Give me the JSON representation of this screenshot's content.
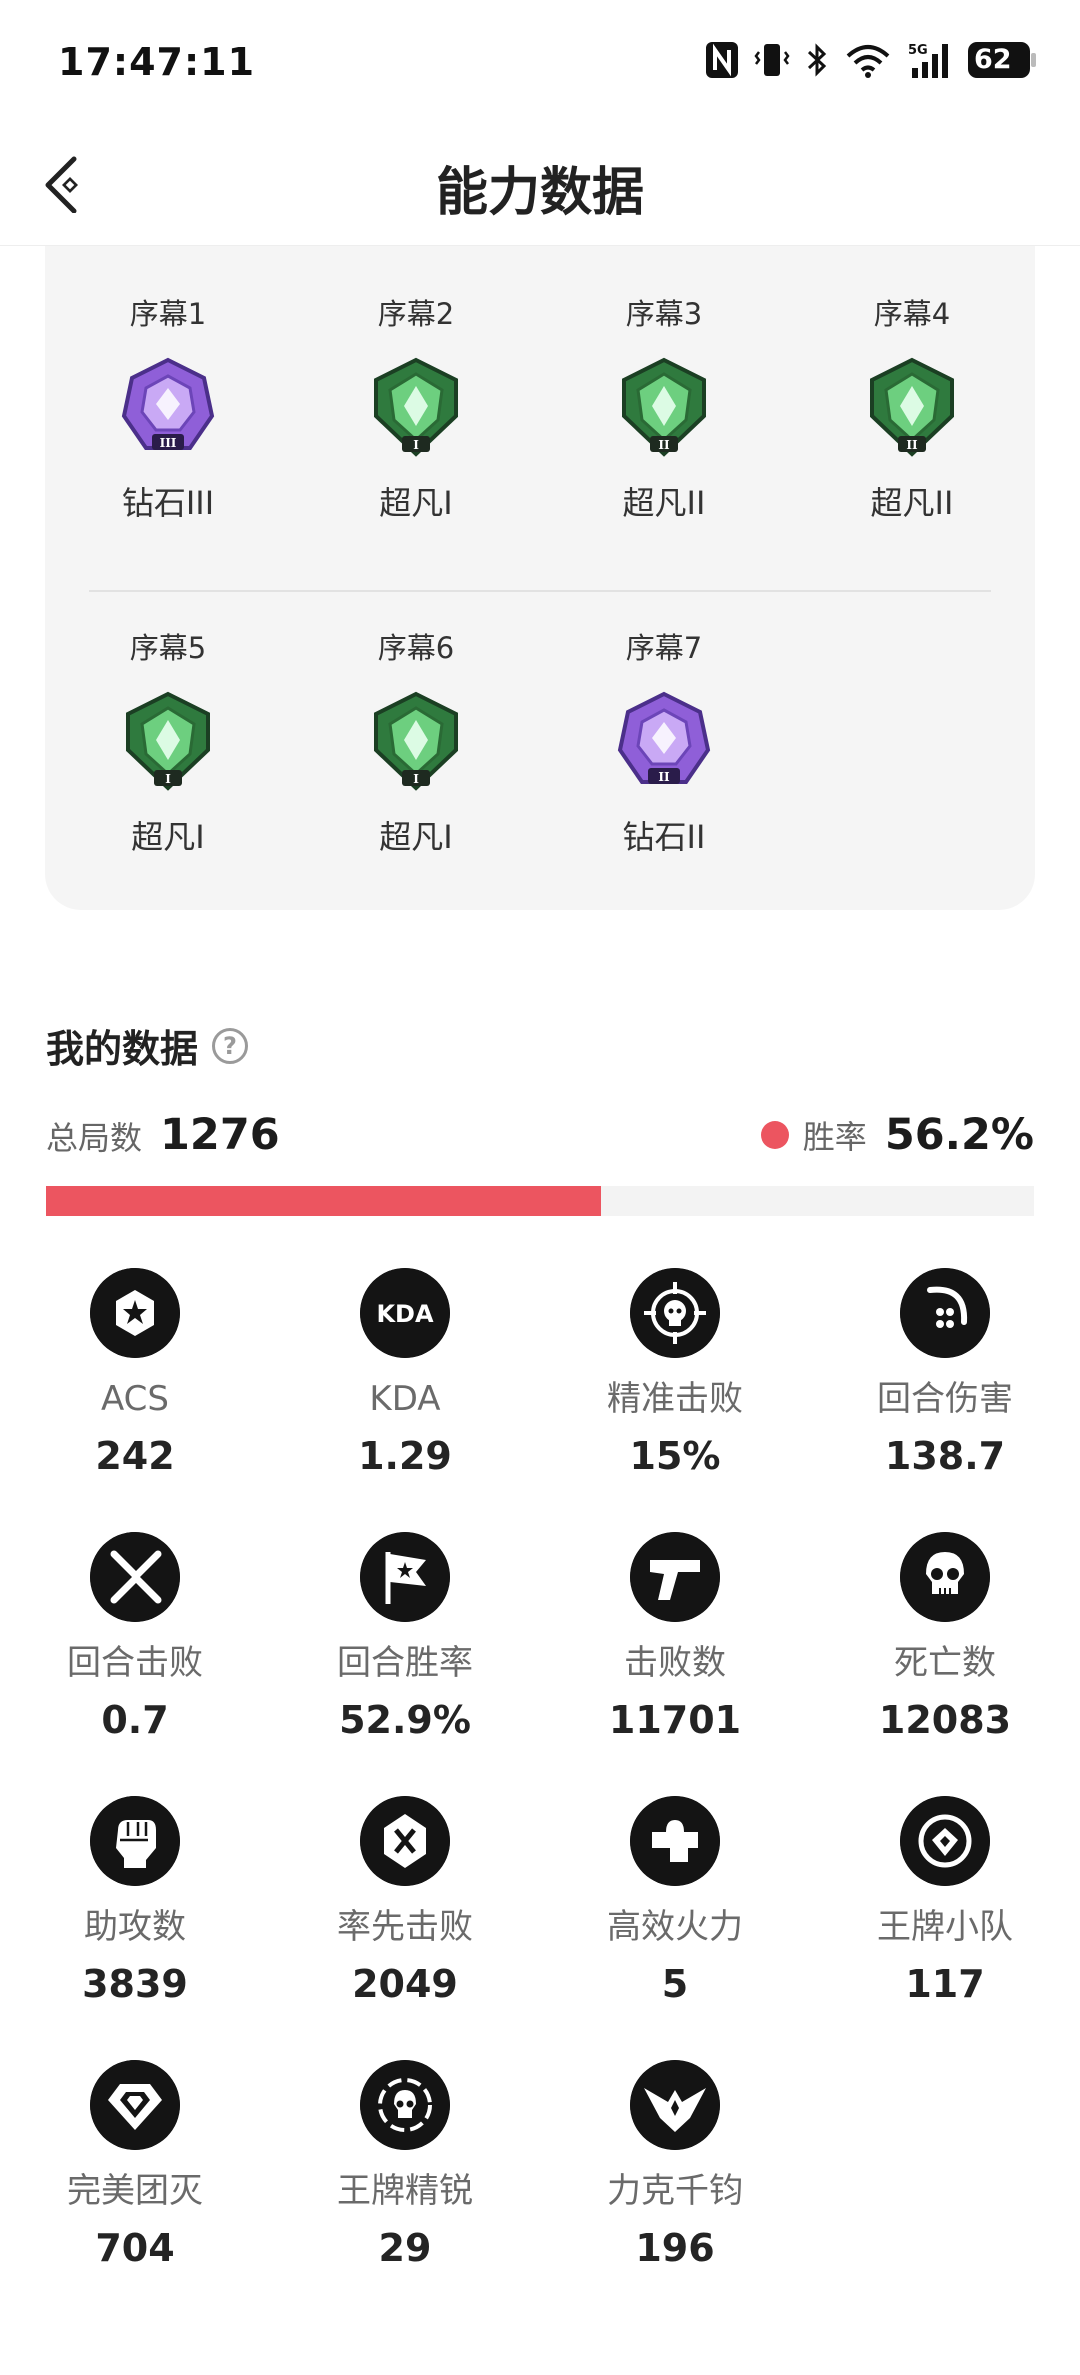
{
  "status_bar": {
    "time": "17:47:11",
    "battery": "62"
  },
  "header": {
    "title": "能力数据"
  },
  "ranks": [
    {
      "act": "序幕1",
      "rank": "钻石III",
      "tier": "diamond",
      "numeral": "III"
    },
    {
      "act": "序幕2",
      "rank": "超凡I",
      "tier": "ascendant",
      "numeral": "I"
    },
    {
      "act": "序幕3",
      "rank": "超凡II",
      "tier": "ascendant",
      "numeral": "II"
    },
    {
      "act": "序幕4",
      "rank": "超凡II",
      "tier": "ascendant",
      "numeral": "II"
    },
    {
      "act": "序幕5",
      "rank": "超凡I",
      "tier": "ascendant",
      "numeral": "I"
    },
    {
      "act": "序幕6",
      "rank": "超凡I",
      "tier": "ascendant",
      "numeral": "I"
    },
    {
      "act": "序幕7",
      "rank": "钻石II",
      "tier": "diamond",
      "numeral": "II"
    }
  ],
  "my_data": {
    "title": "我的数据",
    "help_icon": "question-circle-icon",
    "total_label": "总局数",
    "total_value": "1276",
    "winrate_label": "胜率",
    "winrate_value": "56.2%",
    "winrate_fraction": 0.562,
    "accent_color": "#ec5560"
  },
  "stats": [
    {
      "label": "ACS",
      "value": "242",
      "icon": "star-badge-icon"
    },
    {
      "label": "KDA",
      "value": "1.29",
      "icon": "kda-icon",
      "icon_text": "KDA"
    },
    {
      "label": "精准击败",
      "value": "15%",
      "icon": "crosshair-skull-icon"
    },
    {
      "label": "回合伤害",
      "value": "138.7",
      "icon": "claw-icon"
    },
    {
      "label": "回合击败",
      "value": "0.7",
      "icon": "crossed-blades-icon"
    },
    {
      "label": "回合胜率",
      "value": "52.9%",
      "icon": "flag-icon"
    },
    {
      "label": "击败数",
      "value": "11701",
      "icon": "pistol-icon"
    },
    {
      "label": "死亡数",
      "value": "12083",
      "icon": "skull-icon"
    },
    {
      "label": "助攻数",
      "value": "3839",
      "icon": "fist-icon"
    },
    {
      "label": "率先击败",
      "value": "2049",
      "icon": "first-blood-icon"
    },
    {
      "label": "高效火力",
      "value": "5",
      "icon": "puzzle-icon"
    },
    {
      "label": "王牌小队",
      "value": "117",
      "icon": "team-ace-icon"
    },
    {
      "label": "完美团灭",
      "value": "704",
      "icon": "diamond-icon"
    },
    {
      "label": "王牌精锐",
      "value": "29",
      "icon": "skull-ring-icon"
    },
    {
      "label": "力克千钧",
      "value": "196",
      "icon": "eagle-icon"
    }
  ]
}
